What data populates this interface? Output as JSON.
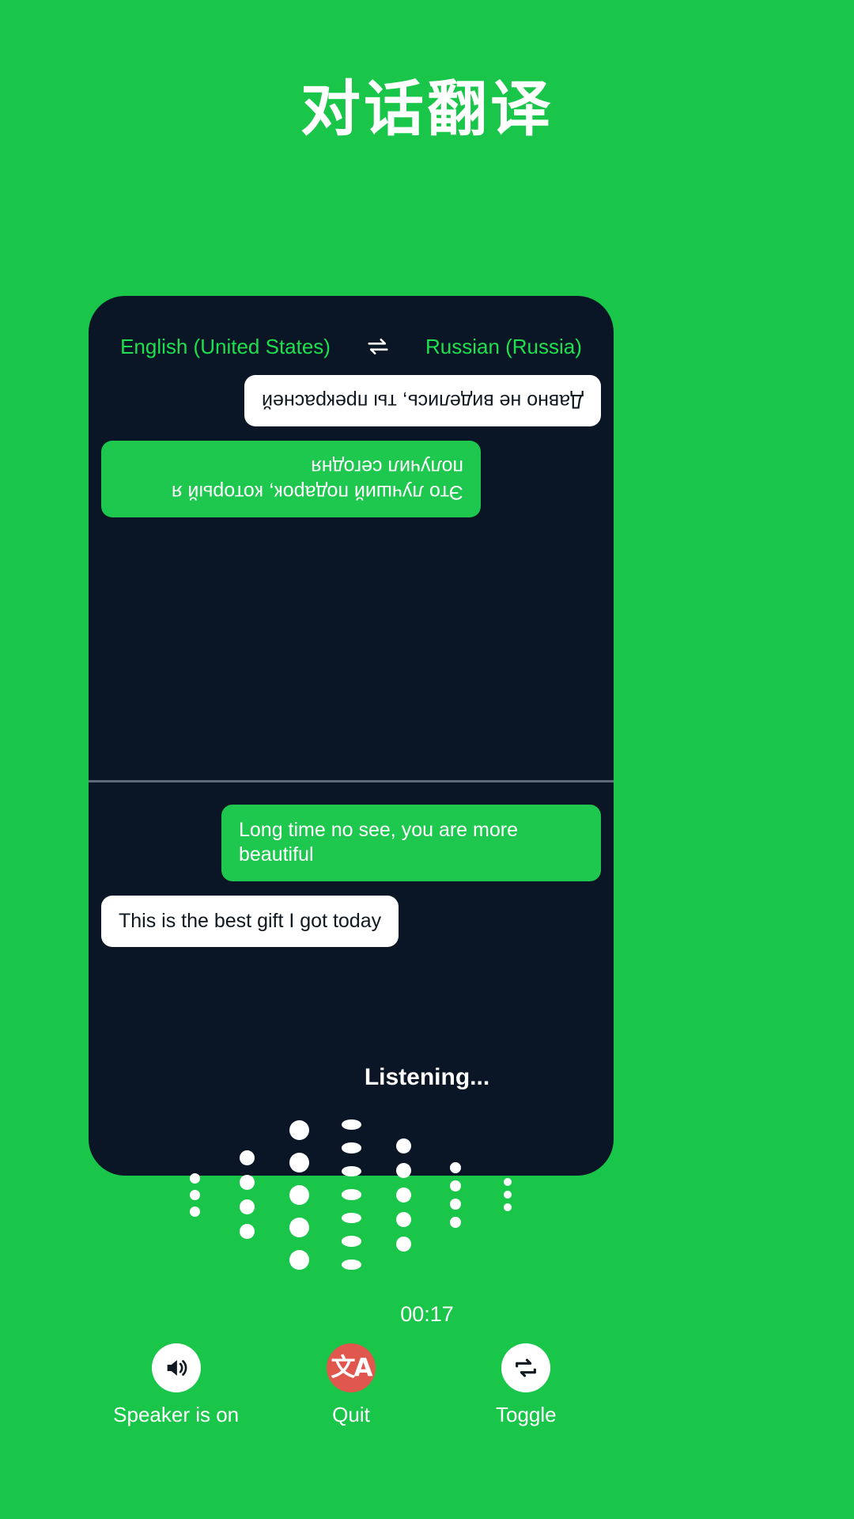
{
  "page": {
    "title": "对话翻译",
    "background_color": "#19c64a",
    "panel_color": "#0a1626",
    "accent_green": "#1ec74e",
    "danger_red": "#e0574d"
  },
  "language_bar": {
    "source_language": "English (United States)",
    "target_language": "Russian (Russia)",
    "swap_icon": "swap-horizontal-icon"
  },
  "conversation": {
    "remote_panel": {
      "rotated": true,
      "messages": [
        {
          "text": "Это лучший подарок, который я получил сегодня",
          "style": "green",
          "align": "right"
        },
        {
          "text": "Давно не виделись, ты прекрасней",
          "style": "white",
          "align": "left"
        }
      ]
    },
    "local_panel": {
      "rotated": false,
      "messages": [
        {
          "text": "Long time no see, you are more beautiful",
          "style": "green",
          "align": "right"
        },
        {
          "text": "This is the best gift I got today",
          "style": "white",
          "align": "left"
        }
      ]
    }
  },
  "status": {
    "listening_label": "Listening...",
    "timer": "00:17"
  },
  "waveform": {
    "columns": [
      {
        "count": 3,
        "size": 13
      },
      {
        "count": 4,
        "size": 19
      },
      {
        "count": 5,
        "size": 25
      },
      {
        "count": 7,
        "size": 25
      },
      {
        "count": 5,
        "size": 19
      },
      {
        "count": 4,
        "size": 14
      },
      {
        "count": 3,
        "size": 10
      }
    ]
  },
  "controls": [
    {
      "label": "Speaker is on",
      "icon": "speaker-on-icon",
      "circle_style": "light"
    },
    {
      "label": "Quit",
      "icon": "translate-icon",
      "circle_style": "danger",
      "glyph": "文A"
    },
    {
      "label": "Toggle",
      "icon": "toggle-swap-icon",
      "circle_style": "light"
    }
  ]
}
